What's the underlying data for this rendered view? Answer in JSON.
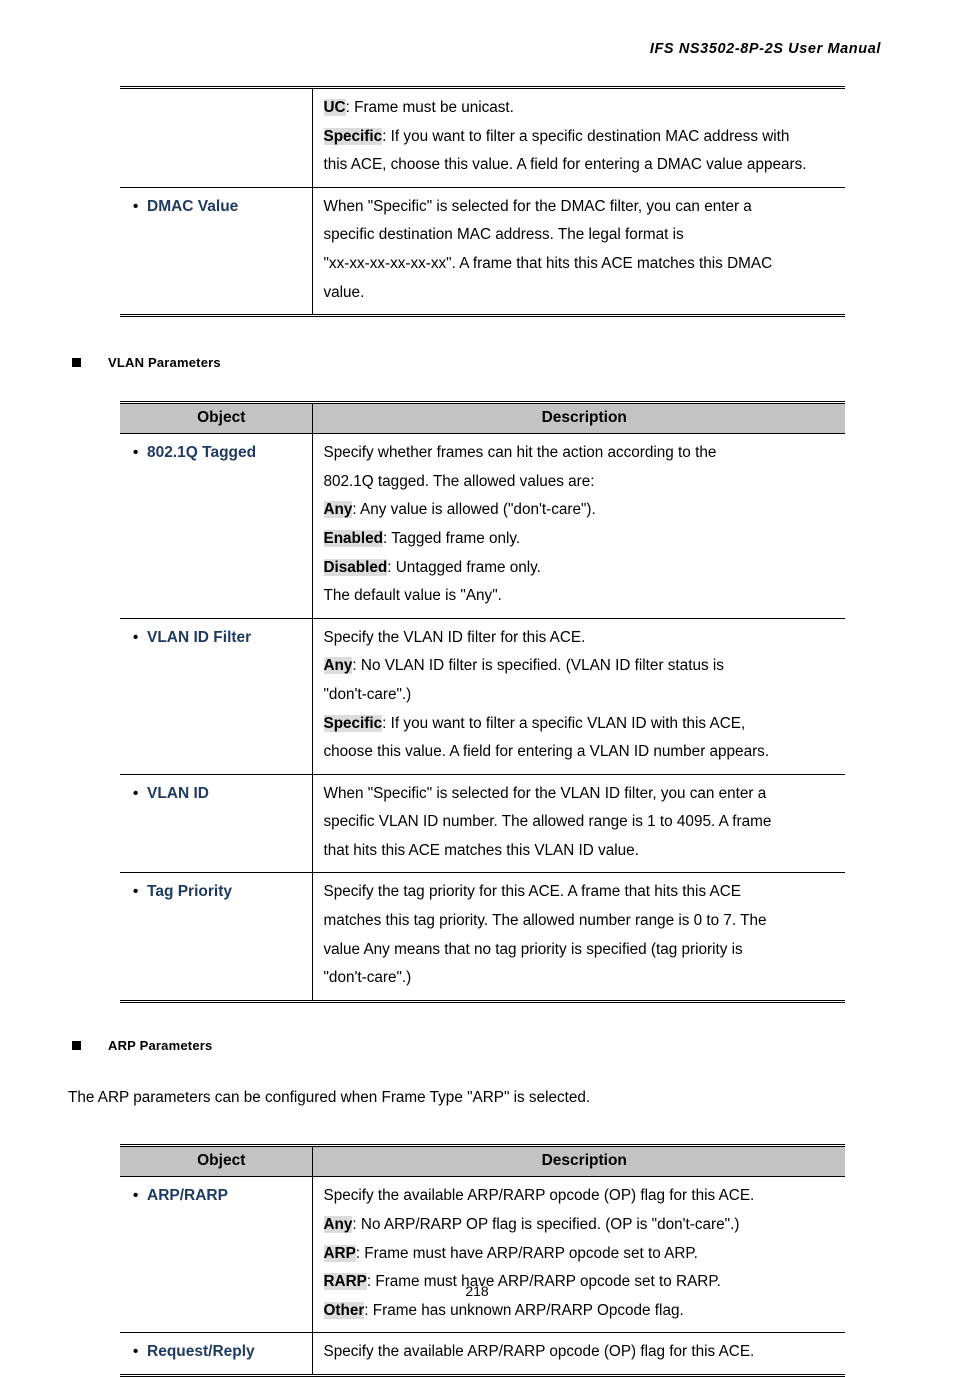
{
  "header": {
    "running_title": "IFS  NS3502-8P-2S  User  Manual"
  },
  "footer": {
    "page_number": "218"
  },
  "table_headers": {
    "object": "Object",
    "description": "Description"
  },
  "bullet_glyph": "•",
  "dmac_table": {
    "rows": [
      {
        "object": "",
        "lines": [
          {
            "term": "UC",
            "text": ": Frame must be unicast."
          },
          {
            "term": "Specific",
            "text": ": If you want to filter a specific destination MAC address with"
          },
          {
            "term": "",
            "text": "this ACE, choose this value. A field for entering a DMAC value appears."
          }
        ]
      },
      {
        "object": "DMAC Value",
        "lines": [
          {
            "term": "",
            "text": "When \"Specific\" is selected for the DMAC filter, you can enter a"
          },
          {
            "term": "",
            "text": "specific destination MAC address. The legal format is"
          },
          {
            "term": "",
            "text": "\"xx-xx-xx-xx-xx-xx\". A frame that hits this ACE matches this DMAC"
          },
          {
            "term": "",
            "text": "value."
          }
        ]
      }
    ]
  },
  "vlan_section": {
    "heading": "VLAN Parameters",
    "rows": [
      {
        "object": "802.1Q Tagged",
        "lines": [
          {
            "term": "",
            "text": "Specify whether frames can hit the action according to the"
          },
          {
            "term": "",
            "text": "802.1Q tagged. The allowed values are:"
          },
          {
            "term": "Any",
            "text": ": Any value is allowed (\"don't-care\")."
          },
          {
            "term": "Enabled",
            "text": ": Tagged frame only."
          },
          {
            "term": "Disabled",
            "text": ": Untagged frame only."
          },
          {
            "term": "",
            "text": "The default value is \"Any\"."
          }
        ]
      },
      {
        "object": "VLAN ID Filter",
        "lines": [
          {
            "term": "",
            "text": "Specify the VLAN ID filter for this ACE."
          },
          {
            "term": "Any",
            "text": ": No VLAN ID filter is specified. (VLAN ID filter status is"
          },
          {
            "term": "",
            "text": "\"don't-care\".)"
          },
          {
            "term": "Specific",
            "text": ": If you want to filter a specific VLAN ID with this ACE,"
          },
          {
            "term": "",
            "text": "choose this value. A field for entering a VLAN ID number appears."
          }
        ]
      },
      {
        "object": "VLAN ID",
        "lines": [
          {
            "term": "",
            "text": "When \"Specific\" is selected for the VLAN ID filter, you can enter a"
          },
          {
            "term": "",
            "text": "specific VLAN ID number. The allowed range is 1 to 4095. A frame"
          },
          {
            "term": "",
            "text": "that hits this ACE matches this VLAN ID value."
          }
        ]
      },
      {
        "object": "Tag Priority",
        "lines": [
          {
            "term": "",
            "text": "Specify the tag priority for this ACE. A frame that hits this ACE"
          },
          {
            "term": "",
            "text": "matches this tag priority. The allowed number range is 0 to 7. The"
          },
          {
            "term": "",
            "text": "value Any means that no tag priority is specified (tag priority is"
          },
          {
            "term": "",
            "text": "\"don't-care\".)"
          }
        ]
      }
    ]
  },
  "arp_section": {
    "heading": "ARP Parameters",
    "intro": "The ARP parameters can be configured when Frame Type \"ARP\" is selected.",
    "rows": [
      {
        "object": "ARP/RARP",
        "lines": [
          {
            "term": "",
            "text": "Specify the available ARP/RARP opcode (OP) flag for this ACE."
          },
          {
            "term": "Any",
            "text": ": No ARP/RARP OP flag is specified. (OP is \"don't-care\".)"
          },
          {
            "term": "ARP",
            "text": ": Frame must have ARP/RARP opcode set to ARP."
          },
          {
            "term": "RARP",
            "text": ": Frame must have ARP/RARP opcode set to RARP."
          },
          {
            "term": "Other",
            "text": ": Frame has unknown ARP/RARP Opcode flag."
          }
        ]
      },
      {
        "object": "Request/Reply",
        "lines": [
          {
            "term": "",
            "text": "Specify the available ARP/RARP opcode (OP) flag for this ACE."
          }
        ]
      }
    ]
  }
}
